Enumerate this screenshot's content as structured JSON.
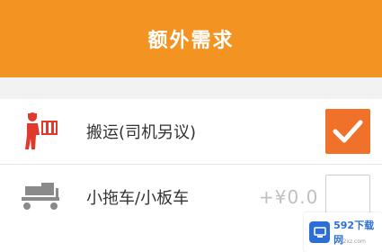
{
  "header": {
    "title": "额外需求"
  },
  "options": [
    {
      "label": "搬运(司机另议)",
      "icon": "porter-carrying-box-icon",
      "checked": true
    },
    {
      "label": "小拖车/小板车",
      "icon": "hand-cart-icon",
      "checked": false,
      "price": "+¥0.0"
    }
  ],
  "watermark": {
    "text": "592下载网",
    "url": "592xz.com"
  },
  "colors": {
    "header": "#f39322",
    "checkbox_checked": "#f0722a",
    "icon_red": "#e03a2f"
  }
}
